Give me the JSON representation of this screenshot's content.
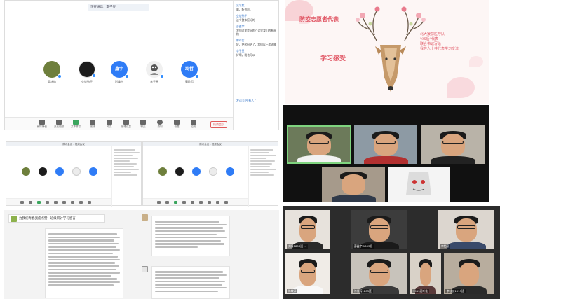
{
  "meeting": {
    "title": "正在讲话：李子昱",
    "participants": [
      {
        "name": "吴冰航",
        "avatar_text": "",
        "color": "#6e7f3c"
      },
      {
        "name": "会谈鸭子",
        "avatar_text": "",
        "color": "#1c1c1c"
      },
      {
        "name": "彭鑫宇",
        "avatar_text": "鑫宇",
        "color": "#2f7cf6"
      },
      {
        "name": "李子昱",
        "avatar_text": "",
        "color": "#f0f0f0"
      },
      {
        "name": "郭玲哲",
        "avatar_text": "玲哲",
        "color": "#2f7cf6"
      }
    ],
    "toolbar": [
      "解除静音",
      "开启视频",
      "共享屏幕",
      "邀请",
      "成员",
      "管理成员",
      "聊天",
      "录制",
      "设置",
      "应用",
      "设置"
    ],
    "leave_label": "结束会议",
    "chat": [
      {
        "who": "吴冰航",
        "text": "嗯，听到啦。"
      },
      {
        "who": "会谈鸭子",
        "text": "这个整体挺好的"
      },
      {
        "who": "彭鑫宇",
        "text": "我们这里是好的？这里我们的新闻稿"
      },
      {
        "who": "郭玲哲",
        "text": "好，把这份给了，我们以一次讲稿"
      },
      {
        "who": "李子昱",
        "text": "好啊，我也可以"
      }
    ],
    "chat_footer": "发送至 所有人 ˅"
  },
  "slide": {
    "tag_left": "防疫志愿者代表",
    "tag_bottom": "学习感受",
    "right_lines": [
      "北大援鄂医疗队",
      "\"95后\"代表",
      "联合书记写给",
      "我在人士并代表学习交流"
    ]
  },
  "mini_windows": [
    {
      "title": "腾讯会议 - 视频会议"
    },
    {
      "title": "腾讯会议 - 视频会议"
    }
  ],
  "doc": {
    "header": "为我们青春战疫点赞 · 班级研讨学习感言"
  },
  "gallery_top": [
    {
      "name": ""
    },
    {
      "name": ""
    },
    {
      "name": ""
    },
    {
      "name": ""
    },
    {
      "name": ""
    }
  ],
  "gallery_bottom": [
    {
      "name": "刘倩1803班 ..."
    },
    {
      "name": "彭鑫宇-1803班"
    },
    {
      "name": "李铭豪"
    },
    {
      "name": "陈敬淳"
    },
    {
      "name": "徐佳芮1803班"
    },
    {
      "name": "1913班叶佳"
    },
    {
      "name": "李佳仪1913班"
    }
  ]
}
